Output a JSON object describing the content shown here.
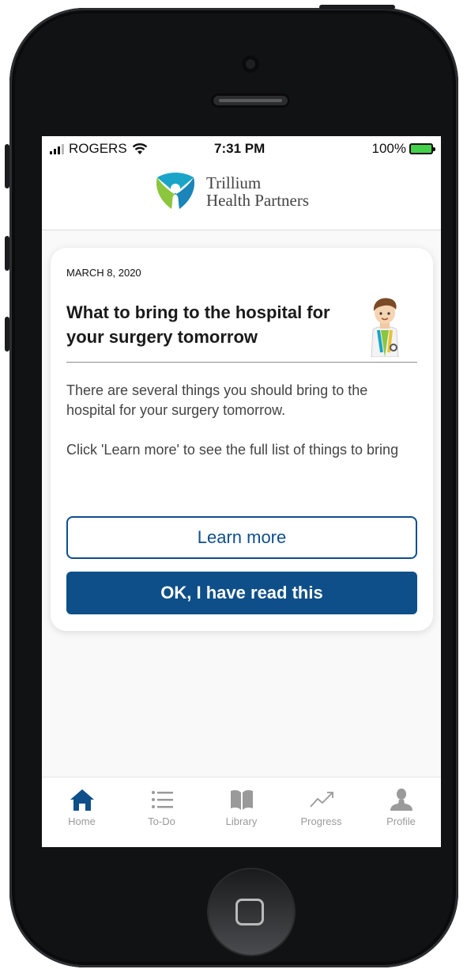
{
  "status_bar": {
    "carrier": "ROGERS",
    "time": "7:31 PM",
    "battery": "100%"
  },
  "header": {
    "logo_line1": "Trillium",
    "logo_line2": "Health Partners"
  },
  "card": {
    "date": "MARCH 8, 2020",
    "title": "What to bring to the hospital for your surgery tomorrow",
    "paragraphs": [
      "There are several things you should bring to the hospital for your surgery tomorrow.",
      "Click 'Learn more' to see the full list of things to bring"
    ],
    "learn_more_label": "Learn more",
    "ok_label": "OK, I have read this"
  },
  "tabs": [
    {
      "label": "Home",
      "icon": "home-icon",
      "active": true
    },
    {
      "label": "To-Do",
      "icon": "list-icon"
    },
    {
      "label": "Library",
      "icon": "book-icon"
    },
    {
      "label": "Progress",
      "icon": "trend-icon"
    },
    {
      "label": "Profile",
      "icon": "person-icon"
    }
  ],
  "colors": {
    "primary": "#0e4f89",
    "logo_teal": "#1aa5c8",
    "logo_green": "#8cc63f",
    "tab_active": "#0e4f89",
    "tab_inactive": "#9a9a9a"
  }
}
